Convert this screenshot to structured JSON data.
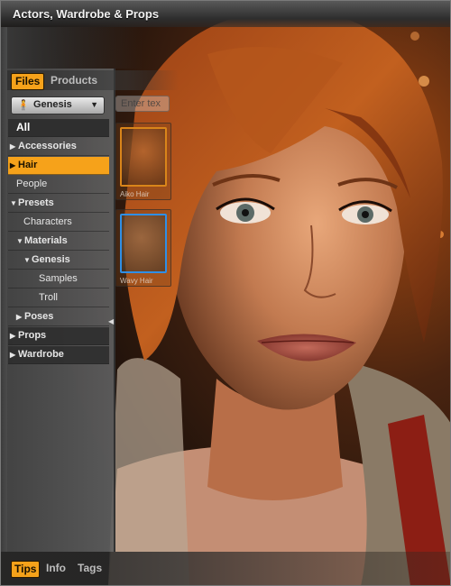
{
  "window": {
    "title": "Actors, Wardrobe & Props"
  },
  "tabs": [
    {
      "label": "Files",
      "active": true
    },
    {
      "label": "Products",
      "active": false
    }
  ],
  "selector": {
    "value": "Genesis",
    "icon": "figure-icon"
  },
  "search": {
    "placeholder": "Enter tex"
  },
  "tree": [
    {
      "label": "All",
      "level": 0,
      "expander": "",
      "style": "all"
    },
    {
      "label": "Accessories",
      "level": 0,
      "expander": "collapsed",
      "style": "bold"
    },
    {
      "label": "Hair",
      "level": 0,
      "expander": "collapsed",
      "style": "selected"
    },
    {
      "label": "People",
      "level": 0,
      "expander": "",
      "style": "normal"
    },
    {
      "label": "Presets",
      "level": 0,
      "expander": "expanded",
      "style": "bold"
    },
    {
      "label": "Characters",
      "level": 1,
      "expander": "",
      "style": "normal"
    },
    {
      "label": "Materials",
      "level": 1,
      "expander": "expanded",
      "style": "bold"
    },
    {
      "label": "Genesis",
      "level": 2,
      "expander": "expanded",
      "style": "bold"
    },
    {
      "label": "Samples",
      "level": 3,
      "expander": "",
      "style": "normal"
    },
    {
      "label": "Troll",
      "level": 3,
      "expander": "",
      "style": "normal"
    },
    {
      "label": "Poses",
      "level": 1,
      "expander": "collapsed",
      "style": "bold"
    },
    {
      "label": "Props",
      "level": 0,
      "expander": "collapsed",
      "style": "bold-dark"
    },
    {
      "label": "Wardrobe",
      "level": 0,
      "expander": "collapsed",
      "style": "bold-dark"
    }
  ],
  "thumbnails": [
    {
      "caption": "Aiko Hair",
      "accent": "#d9851a"
    },
    {
      "caption": "Wavy Hair",
      "accent": "#2f8fe6"
    }
  ],
  "bottom_tabs": [
    {
      "label": "Tips",
      "active": true
    },
    {
      "label": "Info",
      "active": false
    },
    {
      "label": "Tags",
      "active": false
    }
  ],
  "colors": {
    "accent": "#f6a21a",
    "panel": "#4a4a4a"
  }
}
